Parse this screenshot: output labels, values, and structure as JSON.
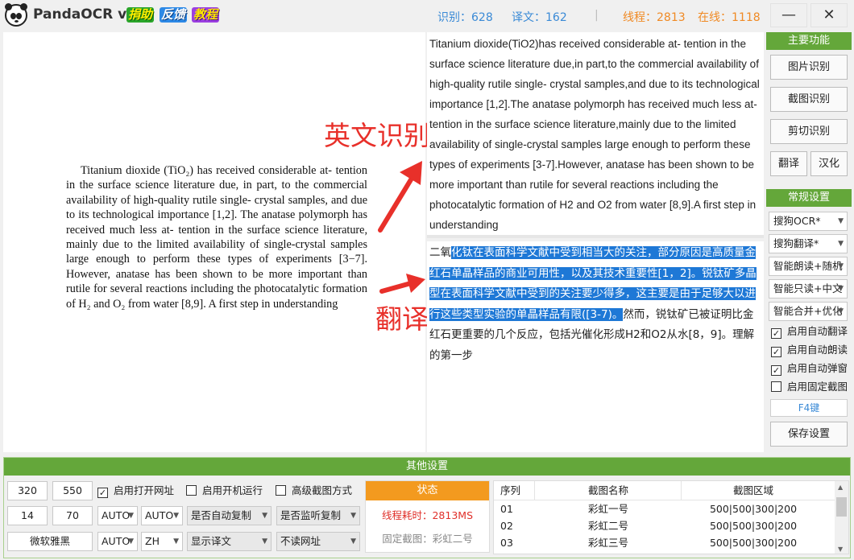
{
  "app": {
    "title": "PandaOCR v2.5",
    "promo": [
      "捐助",
      "反馈",
      "教程"
    ],
    "stats": {
      "recognize": "识别：628",
      "translate": "译文：162",
      "separator": "|",
      "threads": "线程：2813",
      "online": "在线：1118"
    },
    "minimize": "—",
    "close": "✕"
  },
  "source": {
    "paragraph": "Titanium dioxide (TiO₂) has received considerable at- tention in the surface science literature due, in part, to the commercial availability of high-quality rutile single- crystal samples, and due to its technological importance [1,2]. The anatase polymorph has received much less at- tention in the surface science literature, mainly due to the limited availability of single-crystal samples large enough to perform these types of experiments [3−7]. However, anatase has been shown to be more important than rutile for several reactions including the photocatalytic formation of H₂ and O₂ from water [8,9]. A first step in understanding"
  },
  "annotations": {
    "ocr": "英文识别",
    "translate": "翻译"
  },
  "ocr_text": "Titanium dioxide(TiO2)has received considerable at- tention in the surface science literature due,in part,to the commercial availability of high-quality rutile single- crystal samples,and due to its technological importance [1,2].The anatase polymorph has received much less at- tention in the surface science literature,mainly due to the limited availability of single-crystal samples large enough to perform these types of experiments [3-7].However, anatase has been shown to be more important than rutile for several reactions including the photocatalytic formation of H2 and O2 from water [8,9].A first step in understanding",
  "translation": {
    "pre": "二氧",
    "selected": "化钛在表面科学文献中受到相当大的关注，部分原因是高质量金红石单晶样品的商业可用性，以及其技术重要性[1，2]。锐钛矿多晶型在表面科学文献中受到的关注要少得多，这主要是由于足够大以进行这些类型实验的单晶样品有限([3-7)。",
    "post": "然而，锐钛矿已被证明比金红石更重要的几个反应，包括光催化形成H2和O2从水[8，9]。理解的第一步"
  },
  "panel": {
    "main_title": "主要功能",
    "buttons": [
      "图片识别",
      "截图识别",
      "剪切识别",
      "翻译",
      "汉化"
    ],
    "settings_title": "常规设置",
    "selects": [
      "搜狗OCR*",
      "搜狗翻译*",
      "智能朗读+随机",
      "智能只读+中文",
      "智能合并+优化"
    ],
    "checks": [
      {
        "label": "启用自动翻译",
        "checked": true
      },
      {
        "label": "启用自动朗读",
        "checked": true
      },
      {
        "label": "启用自动弹窗",
        "checked": true
      },
      {
        "label": "启用固定截图",
        "checked": false
      }
    ],
    "hotkey": "F4键",
    "save": "保存设置"
  },
  "bottom": {
    "title": "其他设置",
    "fields": {
      "w": "320",
      "h": "550",
      "a": "14",
      "b": "70",
      "font": "微软雅黑"
    },
    "checks": [
      {
        "label": "启用打开网址",
        "checked": true
      },
      {
        "label": "启用开机运行",
        "checked": false
      },
      {
        "label": "高级截图方式",
        "checked": false
      }
    ],
    "selects": {
      "s1": "AUTO",
      "s2": "AUTO",
      "s3": "AUTO",
      "s4": "ZH",
      "copy": "是否自动复制",
      "listen": "是否监听复制",
      "show": "显示译文",
      "url": "不读网址"
    },
    "status": {
      "title": "状态",
      "line1": "线程耗时：2813MS",
      "line2": "固定截图：彩虹二号"
    },
    "table": {
      "headers": [
        "序列",
        "截图名称",
        "截图区域"
      ],
      "rows": [
        [
          "01",
          "彩虹一号",
          "500|500|300|200"
        ],
        [
          "02",
          "彩虹二号",
          "500|500|300|200"
        ],
        [
          "03",
          "彩虹三号",
          "500|500|300|200"
        ]
      ]
    }
  },
  "colors": {
    "green": "#64a73a",
    "blue": "#3a8ad6",
    "orange": "#f08a24",
    "red": "#e8302a",
    "highlight": "#1e78d6"
  }
}
